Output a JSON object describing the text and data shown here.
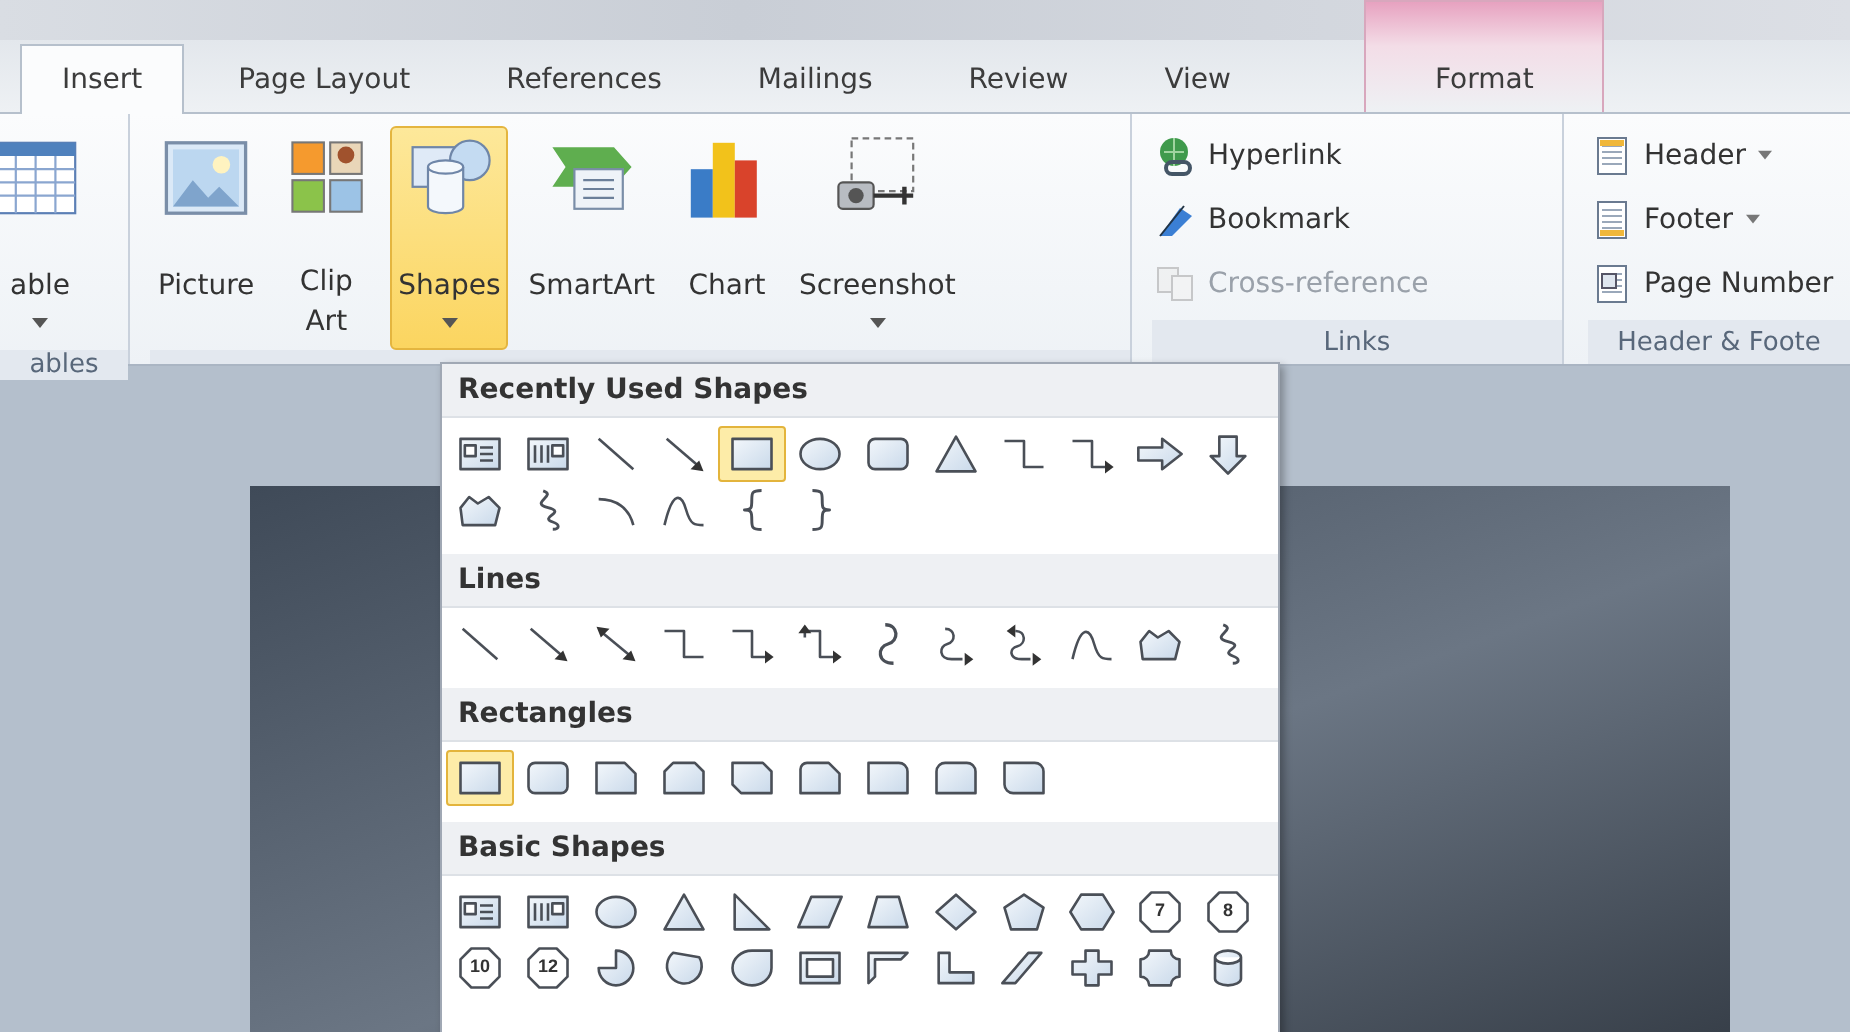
{
  "tabs": [
    {
      "label": "Insert",
      "selected": true,
      "contextual": false
    },
    {
      "label": "Page Layout",
      "selected": false,
      "contextual": false
    },
    {
      "label": "References",
      "selected": false,
      "contextual": false
    },
    {
      "label": "Mailings",
      "selected": false,
      "contextual": false
    },
    {
      "label": "Review",
      "selected": false,
      "contextual": false
    },
    {
      "label": "View",
      "selected": false,
      "contextual": false
    },
    {
      "label": "Format",
      "selected": false,
      "contextual": true
    }
  ],
  "ribbon": {
    "groups": [
      {
        "label": "ables",
        "kind": "large",
        "buttons": [
          {
            "label": "able",
            "kind": "table",
            "dropdown": true,
            "selected": false
          }
        ]
      },
      {
        "kind": "large",
        "buttons": [
          {
            "label": "Picture",
            "kind": "picture",
            "dropdown": false,
            "selected": false
          },
          {
            "label": "Clip Art",
            "kind": "clipart",
            "dropdown": false,
            "selected": false
          },
          {
            "label": "Shapes",
            "kind": "shapes",
            "dropdown": true,
            "selected": true
          },
          {
            "label": "SmartArt",
            "kind": "smartart",
            "dropdown": false,
            "selected": false
          },
          {
            "label": "Chart",
            "kind": "chart",
            "dropdown": false,
            "selected": false
          },
          {
            "label": "Screenshot",
            "kind": "screenshot",
            "dropdown": true,
            "selected": false
          }
        ]
      },
      {
        "label": "Links",
        "kind": "small",
        "buttons": [
          {
            "label": "Hyperlink",
            "kind": "hyperlink",
            "dropdown": false,
            "disabled": false
          },
          {
            "label": "Bookmark",
            "kind": "bookmark",
            "dropdown": false,
            "disabled": false
          },
          {
            "label": "Cross-reference",
            "kind": "crossref",
            "dropdown": false,
            "disabled": true
          }
        ]
      },
      {
        "label": "Header & Foote",
        "kind": "small",
        "buttons": [
          {
            "label": "Header",
            "kind": "header",
            "dropdown": true,
            "disabled": false
          },
          {
            "label": "Footer",
            "kind": "footer",
            "dropdown": true,
            "disabled": false
          },
          {
            "label": "Page Number",
            "kind": "pagenumber",
            "dropdown": false,
            "disabled": false
          }
        ]
      }
    ]
  },
  "gallery": {
    "sections": [
      {
        "title": "Recently Used Shapes",
        "items": [
          {
            "kind": "textbox",
            "selected": false
          },
          {
            "kind": "vtextbox",
            "selected": false
          },
          {
            "kind": "line",
            "selected": false
          },
          {
            "kind": "arrow",
            "selected": false
          },
          {
            "kind": "rect",
            "selected": true
          },
          {
            "kind": "oval",
            "selected": false
          },
          {
            "kind": "roundrect",
            "selected": false
          },
          {
            "kind": "triangle",
            "selected": false
          },
          {
            "kind": "elbow",
            "selected": false
          },
          {
            "kind": "elbowarrow",
            "selected": false
          },
          {
            "kind": "rightarrow",
            "selected": false
          },
          {
            "kind": "downarrow",
            "selected": false
          },
          {
            "kind": "freeform",
            "selected": false
          },
          {
            "kind": "scribble",
            "selected": false
          },
          {
            "kind": "arc",
            "selected": false
          },
          {
            "kind": "curve",
            "selected": false
          },
          {
            "kind": "leftbrace",
            "selected": false
          },
          {
            "kind": "rightbrace",
            "selected": false
          }
        ]
      },
      {
        "title": "Lines",
        "items": [
          {
            "kind": "line",
            "selected": false
          },
          {
            "kind": "arrow",
            "selected": false
          },
          {
            "kind": "dblarrow",
            "selected": false
          },
          {
            "kind": "elbow",
            "selected": false
          },
          {
            "kind": "elbowarrow",
            "selected": false
          },
          {
            "kind": "elbowdbl",
            "selected": false
          },
          {
            "kind": "curved",
            "selected": false
          },
          {
            "kind": "curvedarrow",
            "selected": false
          },
          {
            "kind": "curveddbl",
            "selected": false
          },
          {
            "kind": "curve",
            "selected": false
          },
          {
            "kind": "freeform",
            "selected": false
          },
          {
            "kind": "scribble",
            "selected": false
          }
        ]
      },
      {
        "title": "Rectangles",
        "items": [
          {
            "kind": "rect",
            "selected": true
          },
          {
            "kind": "roundrect",
            "selected": false
          },
          {
            "kind": "snip1",
            "selected": false
          },
          {
            "kind": "snip2same",
            "selected": false
          },
          {
            "kind": "snip2diag",
            "selected": false
          },
          {
            "kind": "snipround",
            "selected": false
          },
          {
            "kind": "round1",
            "selected": false
          },
          {
            "kind": "round2same",
            "selected": false
          },
          {
            "kind": "round2diag",
            "selected": false
          }
        ]
      },
      {
        "title": "Basic Shapes",
        "items": [
          {
            "kind": "textbox",
            "selected": false
          },
          {
            "kind": "vtextbox",
            "selected": false
          },
          {
            "kind": "oval",
            "selected": false
          },
          {
            "kind": "triangle",
            "selected": false
          },
          {
            "kind": "rtriangle",
            "selected": false
          },
          {
            "kind": "parallelogram",
            "selected": false
          },
          {
            "kind": "trapezoid",
            "selected": false
          },
          {
            "kind": "diamond",
            "selected": false
          },
          {
            "kind": "pentagon",
            "selected": false
          },
          {
            "kind": "hexagon",
            "selected": false
          },
          {
            "kind": "polygon",
            "label": "7",
            "selected": false
          },
          {
            "kind": "polygon",
            "label": "8",
            "selected": false
          },
          {
            "kind": "polygon",
            "label": "10",
            "selected": false
          },
          {
            "kind": "polygon",
            "label": "12",
            "selected": false
          },
          {
            "kind": "pie",
            "selected": false
          },
          {
            "kind": "chord",
            "selected": false
          },
          {
            "kind": "teardrop",
            "selected": false
          },
          {
            "kind": "frame",
            "selected": false
          },
          {
            "kind": "halfframe",
            "selected": false
          },
          {
            "kind": "lshape",
            "selected": false
          },
          {
            "kind": "diagstripe",
            "selected": false
          },
          {
            "kind": "cross",
            "selected": false
          },
          {
            "kind": "plaque",
            "selected": false
          },
          {
            "kind": "can",
            "selected": false
          }
        ]
      }
    ]
  }
}
